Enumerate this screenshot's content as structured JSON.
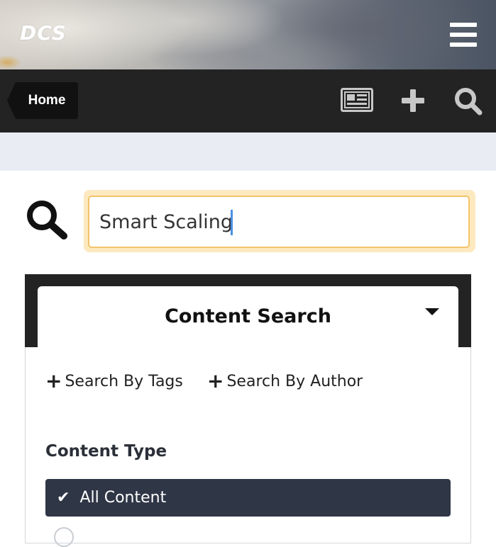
{
  "header": {
    "logo_text": "DCS",
    "menu_icon": "hamburger-menu-icon"
  },
  "nav": {
    "home_label": "Home",
    "icons": [
      "newspaper-icon",
      "plus-icon",
      "search-icon"
    ]
  },
  "search": {
    "icon": "search-icon",
    "value": "Smart Scaling"
  },
  "content_search": {
    "title": "Content Search",
    "toggle_icon": "caret-down-icon",
    "filters": {
      "tags_label": "Search By Tags",
      "author_label": "Search By Author"
    },
    "content_type": {
      "label": "Content Type",
      "selected": "All Content"
    }
  },
  "colors": {
    "navbar_bg": "#232323",
    "search_focus_ring": "#fde9bf",
    "search_border": "#f2c36a",
    "selected_option_bg": "#2f3646"
  }
}
